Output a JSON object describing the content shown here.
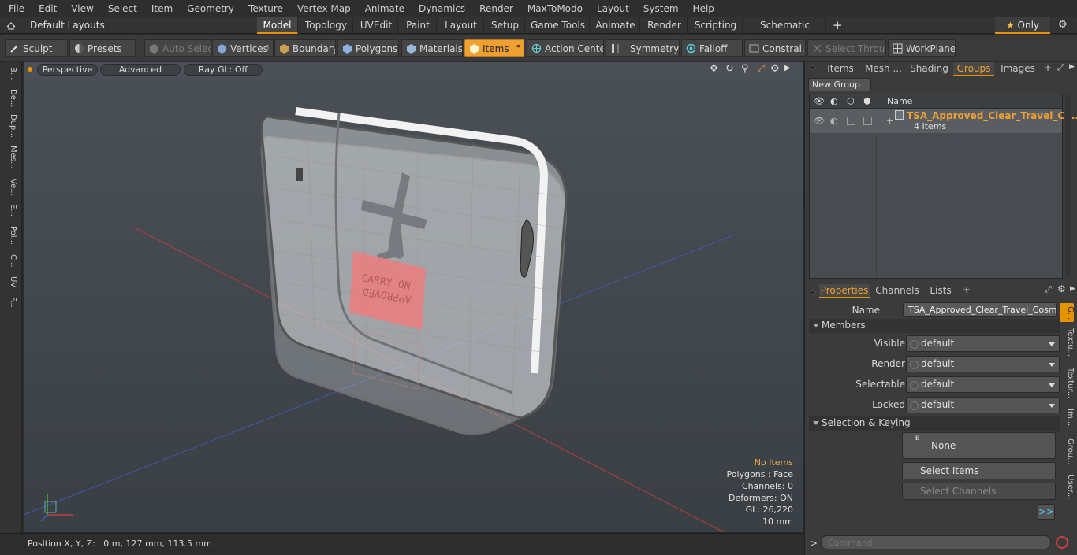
{
  "menu": [
    "File",
    "Edit",
    "View",
    "Select",
    "Item",
    "Geometry",
    "Texture",
    "Vertex Map",
    "Animate",
    "Dynamics",
    "Render",
    "MaxToModo",
    "Layout",
    "System",
    "Help"
  ],
  "layouts": {
    "selector": "Default Layouts",
    "tabs": [
      "Model",
      "Topology",
      "UVEdit",
      "Paint",
      "Layout",
      "Setup",
      "Game Tools",
      "Animate",
      "Render",
      "Scripting",
      "Schematic Fusion"
    ],
    "active": "Model",
    "only_label": "Only"
  },
  "toolbar": {
    "sculpt": "Sculpt",
    "presets": "Presets",
    "auto_select": "Auto Select",
    "vertices": "Vertices",
    "vertices_count": "1",
    "boundary": "Boundary",
    "polygons": "Polygons",
    "materials": "Materials",
    "items": "Items",
    "items_count": "5",
    "action_center": "Action Center",
    "symmetry": "Symmetry",
    "falloff": "Falloff",
    "constraints": "Constrai...",
    "select_through": "Select Through",
    "workplane": "WorkPlane"
  },
  "left_tabs": [
    "B...",
    "De...",
    "Dup...",
    "Mes...",
    "Ve...",
    "E...",
    "Pol...",
    "C...",
    "UV",
    "F..."
  ],
  "viewport": {
    "view_mode": "Perspective",
    "shading": "Advanced",
    "raygl": "Ray GL: Off",
    "stats": {
      "selection": "No Items",
      "polygons": "Polygons : Face",
      "channels": "Channels: 0",
      "deformers": "Deformers: ON",
      "gl": "GL: 26,220",
      "grid": "10 mm"
    },
    "model_label_top": "CARRY ON",
    "model_label_bottom": "APPROVED"
  },
  "status": {
    "position": "Position X, Y, Z:   0 m, 127 mm, 113.5 mm"
  },
  "panel_tabs": [
    "Items",
    "Mesh ...",
    "Shading",
    "Groups",
    "Images"
  ],
  "panel_active": "Groups",
  "groups": {
    "new_group": "New Group",
    "col_name": "Name",
    "item_name": "TSA_Approved_Clear_Travel_C ...",
    "item_sub": "4 Items"
  },
  "props_tabs": [
    "Properties",
    "Channels",
    "Lists"
  ],
  "props_active": "Properties",
  "properties": {
    "name_label": "Name",
    "name_value": "TSA_Approved_Clear_Travel_Cosmeti",
    "members_header": "Members",
    "visible_label": "Visible",
    "visible_value": "default",
    "render_label": "Render",
    "render_value": "default",
    "selectable_label": "Selectable",
    "selectable_value": "default",
    "locked_label": "Locked",
    "locked_value": "default",
    "selkey_header": "Selection & Keying",
    "none_label": "None",
    "select_items": "Select Items",
    "select_channels": "Select Channels",
    "more": ">>"
  },
  "right_vtabs": [
    "G...",
    "Textu...",
    "Textur...",
    "Im...",
    "Grou...",
    "User..."
  ],
  "command": {
    "prompt": ">",
    "placeholder": "Command"
  }
}
